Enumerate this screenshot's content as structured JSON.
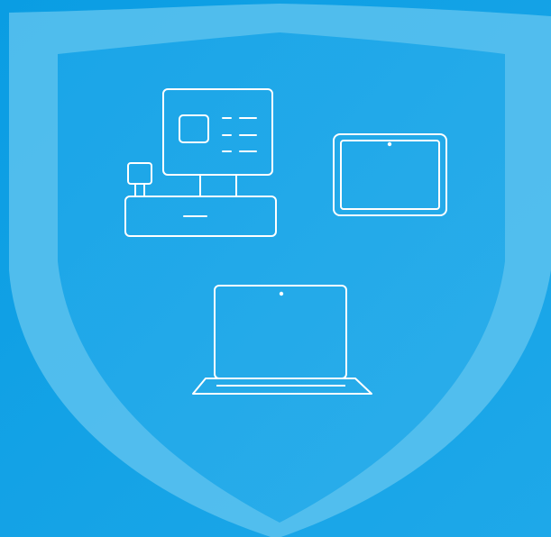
{
  "colors": {
    "background_top_left": "#0a9fe4",
    "background_bottom_right": "#1aa6e8",
    "shield_outer": "#5ec3f0",
    "shield_inner": "#22aaea",
    "device_outline": "#ffffff"
  },
  "icons": {
    "shield": "shield-icon",
    "pos_terminal": "pos-terminal-icon",
    "tablet": "tablet-icon",
    "laptop": "laptop-icon"
  }
}
